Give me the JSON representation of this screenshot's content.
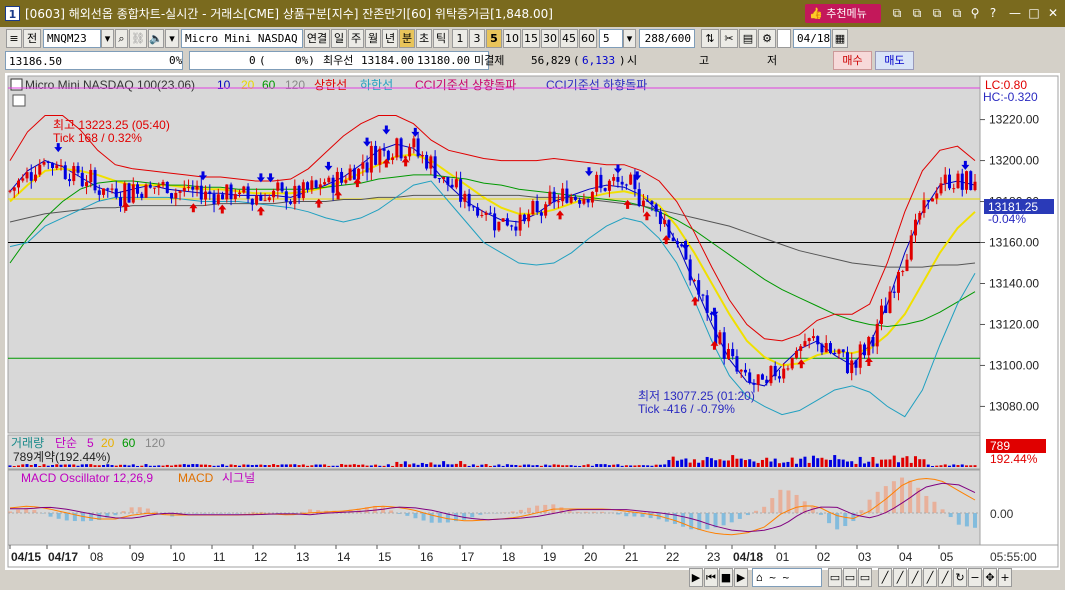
{
  "window": {
    "screen_no": "1",
    "title": "[0603] 해외선옵 종합차트-실시간 - 거래소[CME] 상품구분[지수] 잔존만기[60] 위탁증거금[1,848.00]",
    "recommend_label": "추천메뉴",
    "controls": [
      "⧉",
      "⧉",
      "⧉",
      "⧉",
      "⚲",
      "?",
      "—",
      "□",
      "✕"
    ]
  },
  "toolbar": {
    "period_btn": "전",
    "symbol": "MNQM23",
    "name": "Micro Mini NASDAQ 100",
    "chain_label": "연결",
    "periods": [
      "일",
      "주",
      "월",
      "년",
      "분",
      "초",
      "틱"
    ],
    "active_period": "분",
    "intervals": [
      "1",
      "3",
      "5",
      "10",
      "15",
      "30",
      "45",
      "60"
    ],
    "active_interval": "5",
    "interval_value": "5",
    "count": "288/600",
    "date": "04/18"
  },
  "quote": {
    "price": "13186.50",
    "pct1": "0%",
    "zero": "0",
    "pct2": "0%)",
    "best_ask_label": "최우선",
    "best_ask": "13184.00",
    "best_bid": "13180.00",
    "open_interest_label": "미결제",
    "open_interest": "56,829",
    "oi_change": "6,133",
    "col_open": "시",
    "col_high": "고",
    "col_low": "저",
    "buy_label": "매수",
    "sell_label": "매도"
  },
  "price_panel": {
    "legend_name": "Micro Mini NASDAQ 100(23.06)",
    "legend_ma": [
      "10",
      "20",
      "60",
      "120"
    ],
    "legend_ma_colors": [
      "#0000c0",
      "#e8d800",
      "#009900",
      "#555555"
    ],
    "legend_upper": "상한선",
    "legend_lower": "하한선",
    "legend_cci_up": "CCI기준선 상향돌파",
    "legend_cci_down": "CCI기준선 하향돌파",
    "lc": "LC:0.80",
    "hc": "HC:-0.320",
    "high_label": "최고 13223.25 (05:40)",
    "high_tick": "Tick 168 / 0.32%",
    "low_label": "최저 13077.25 (01:20)",
    "low_tick": "Tick -416 / -0.79%",
    "current_price": "13181.25",
    "current_pct": "-0.04%",
    "y_ticks": [
      "13220.00",
      "13200.00",
      "13180.00",
      "13160.00",
      "13140.00",
      "13120.00",
      "13100.00",
      "13080.00"
    ]
  },
  "volume_panel": {
    "legend_name": "거래량",
    "legend_simple": "단순",
    "legend_ma": [
      "5",
      "20",
      "60",
      "120"
    ],
    "volume_text": "789계약(192.44%)",
    "badge_value": "789",
    "badge_pct": "192.44%"
  },
  "macd_panel": {
    "legend_name": "MACD Oscillator 12,26,9",
    "legend_macd": "MACD",
    "legend_signal": "시그널",
    "y_tick": "0.00"
  },
  "x_axis": {
    "labels": [
      "04/15",
      "04/17",
      "08",
      "09",
      "10",
      "11",
      "12",
      "13",
      "14",
      "15",
      "16",
      "17",
      "18",
      "19",
      "20",
      "21",
      "22",
      "23",
      "04/18",
      "01",
      "02",
      "03",
      "04",
      "05"
    ],
    "time": "05:55:00"
  },
  "colors": {
    "title_bar": "#7a6a1e",
    "up": "#e00000",
    "down": "#0000e0",
    "ma10": "#0000c0",
    "ma20": "#e8d800",
    "ma60": "#009900",
    "ma120": "#555555",
    "band_upper": "#e00000",
    "band_lower": "#20a0c0",
    "macd": "#ff8000",
    "signal": "#800080"
  },
  "chart_data": {
    "type": "candlestick",
    "ylim": [
      13068,
      13232
    ],
    "current": 13181.25,
    "high": 13223.25,
    "low": 13077.25,
    "hlines": [
      13181.25,
      13160.0,
      13103.5
    ],
    "series": [
      {
        "name": "10",
        "values": [
          13185,
          13195,
          13200,
          13197,
          13192,
          13187,
          13184,
          13186,
          13188,
          13186,
          13185,
          13184,
          13184,
          13183,
          13183,
          13183,
          13182,
          13185,
          13188,
          13192,
          13198,
          13205,
          13208,
          13206,
          13198,
          13188,
          13180,
          13175,
          13171,
          13170,
          13174,
          13180,
          13183,
          13186,
          13188,
          13187,
          13183,
          13175,
          13160,
          13140,
          13120,
          13103,
          13092,
          13090,
          13100,
          13108,
          13112,
          13105,
          13100,
          13110,
          13130,
          13155,
          13175,
          13188,
          13190,
          13188
        ]
      },
      {
        "name": "20",
        "values": [
          13180,
          13188,
          13195,
          13196,
          13195,
          13193,
          13190,
          13188,
          13188,
          13188,
          13187,
          13186,
          13186,
          13185,
          13184,
          13184,
          13184,
          13185,
          13187,
          13190,
          13194,
          13198,
          13202,
          13203,
          13200,
          13194,
          13188,
          13182,
          13177,
          13174,
          13174,
          13176,
          13179,
          13182,
          13184,
          13185,
          13183,
          13178,
          13168,
          13155,
          13140,
          13125,
          13112,
          13104,
          13100,
          13101,
          13105,
          13107,
          13106,
          13108,
          13115,
          13125,
          13140,
          13155,
          13167,
          13175
        ]
      },
      {
        "name": "60",
        "values": [
          13150,
          13162,
          13172,
          13180,
          13186,
          13189,
          13190,
          13190,
          13189,
          13188,
          13188,
          13187,
          13187,
          13186,
          13186,
          13186,
          13186,
          13186,
          13187,
          13188,
          13189,
          13191,
          13192,
          13193,
          13193,
          13192,
          13191,
          13189,
          13188,
          13186,
          13185,
          13184,
          13183,
          13182,
          13181,
          13180,
          13178,
          13175,
          13171,
          13166,
          13160,
          13154,
          13148,
          13142,
          13137,
          13133,
          13129,
          13125,
          13122,
          13120,
          13119,
          13120,
          13122,
          13126,
          13131,
          13136
        ]
      },
      {
        "name": "120",
        "values": [
          13170,
          13172,
          13174,
          13175,
          13176,
          13177,
          13177,
          13178,
          13178,
          13178,
          13178,
          13178,
          13179,
          13179,
          13179,
          13179,
          13180,
          13180,
          13180,
          13181,
          13181,
          13182,
          13182,
          13183,
          13183,
          13183,
          13183,
          13183,
          13183,
          13183,
          13182,
          13182,
          13182,
          13181,
          13180,
          13179,
          13178,
          13176,
          13174,
          13172,
          13170,
          13168,
          13165,
          13162,
          13159,
          13156,
          13154,
          13152,
          13150,
          13149,
          13148,
          13148,
          13148,
          13149,
          13149,
          13150
        ]
      },
      {
        "name": "상한선",
        "values": [
          13200,
          13214,
          13222,
          13222,
          13215,
          13205,
          13198,
          13196,
          13195,
          13194,
          13193,
          13192,
          13192,
          13191,
          13190,
          13190,
          13191,
          13196,
          13204,
          13212,
          13218,
          13222,
          13222,
          13218,
          13210,
          13205,
          13203,
          13201,
          13200,
          13200,
          13200,
          13201,
          13200,
          13199,
          13198,
          13198,
          13195,
          13190,
          13180,
          13165,
          13148,
          13132,
          13120,
          13113,
          13112,
          13115,
          13122,
          13125,
          13125,
          13130,
          13150,
          13175,
          13195,
          13205,
          13207,
          13200
        ]
      },
      {
        "name": "하한선",
        "values": [
          13158,
          13160,
          13168,
          13172,
          13176,
          13180,
          13182,
          13182,
          13182,
          13182,
          13181,
          13180,
          13180,
          13180,
          13179,
          13178,
          13177,
          13175,
          13172,
          13170,
          13172,
          13176,
          13182,
          13188,
          13190,
          13180,
          13170,
          13160,
          13155,
          13150,
          13149,
          13150,
          13155,
          13162,
          13168,
          13172,
          13170,
          13162,
          13150,
          13132,
          13112,
          13095,
          13085,
          13080,
          13076,
          13078,
          13083,
          13088,
          13090,
          13087,
          13080,
          13075,
          13088,
          13110,
          13130,
          13145
        ]
      }
    ]
  }
}
